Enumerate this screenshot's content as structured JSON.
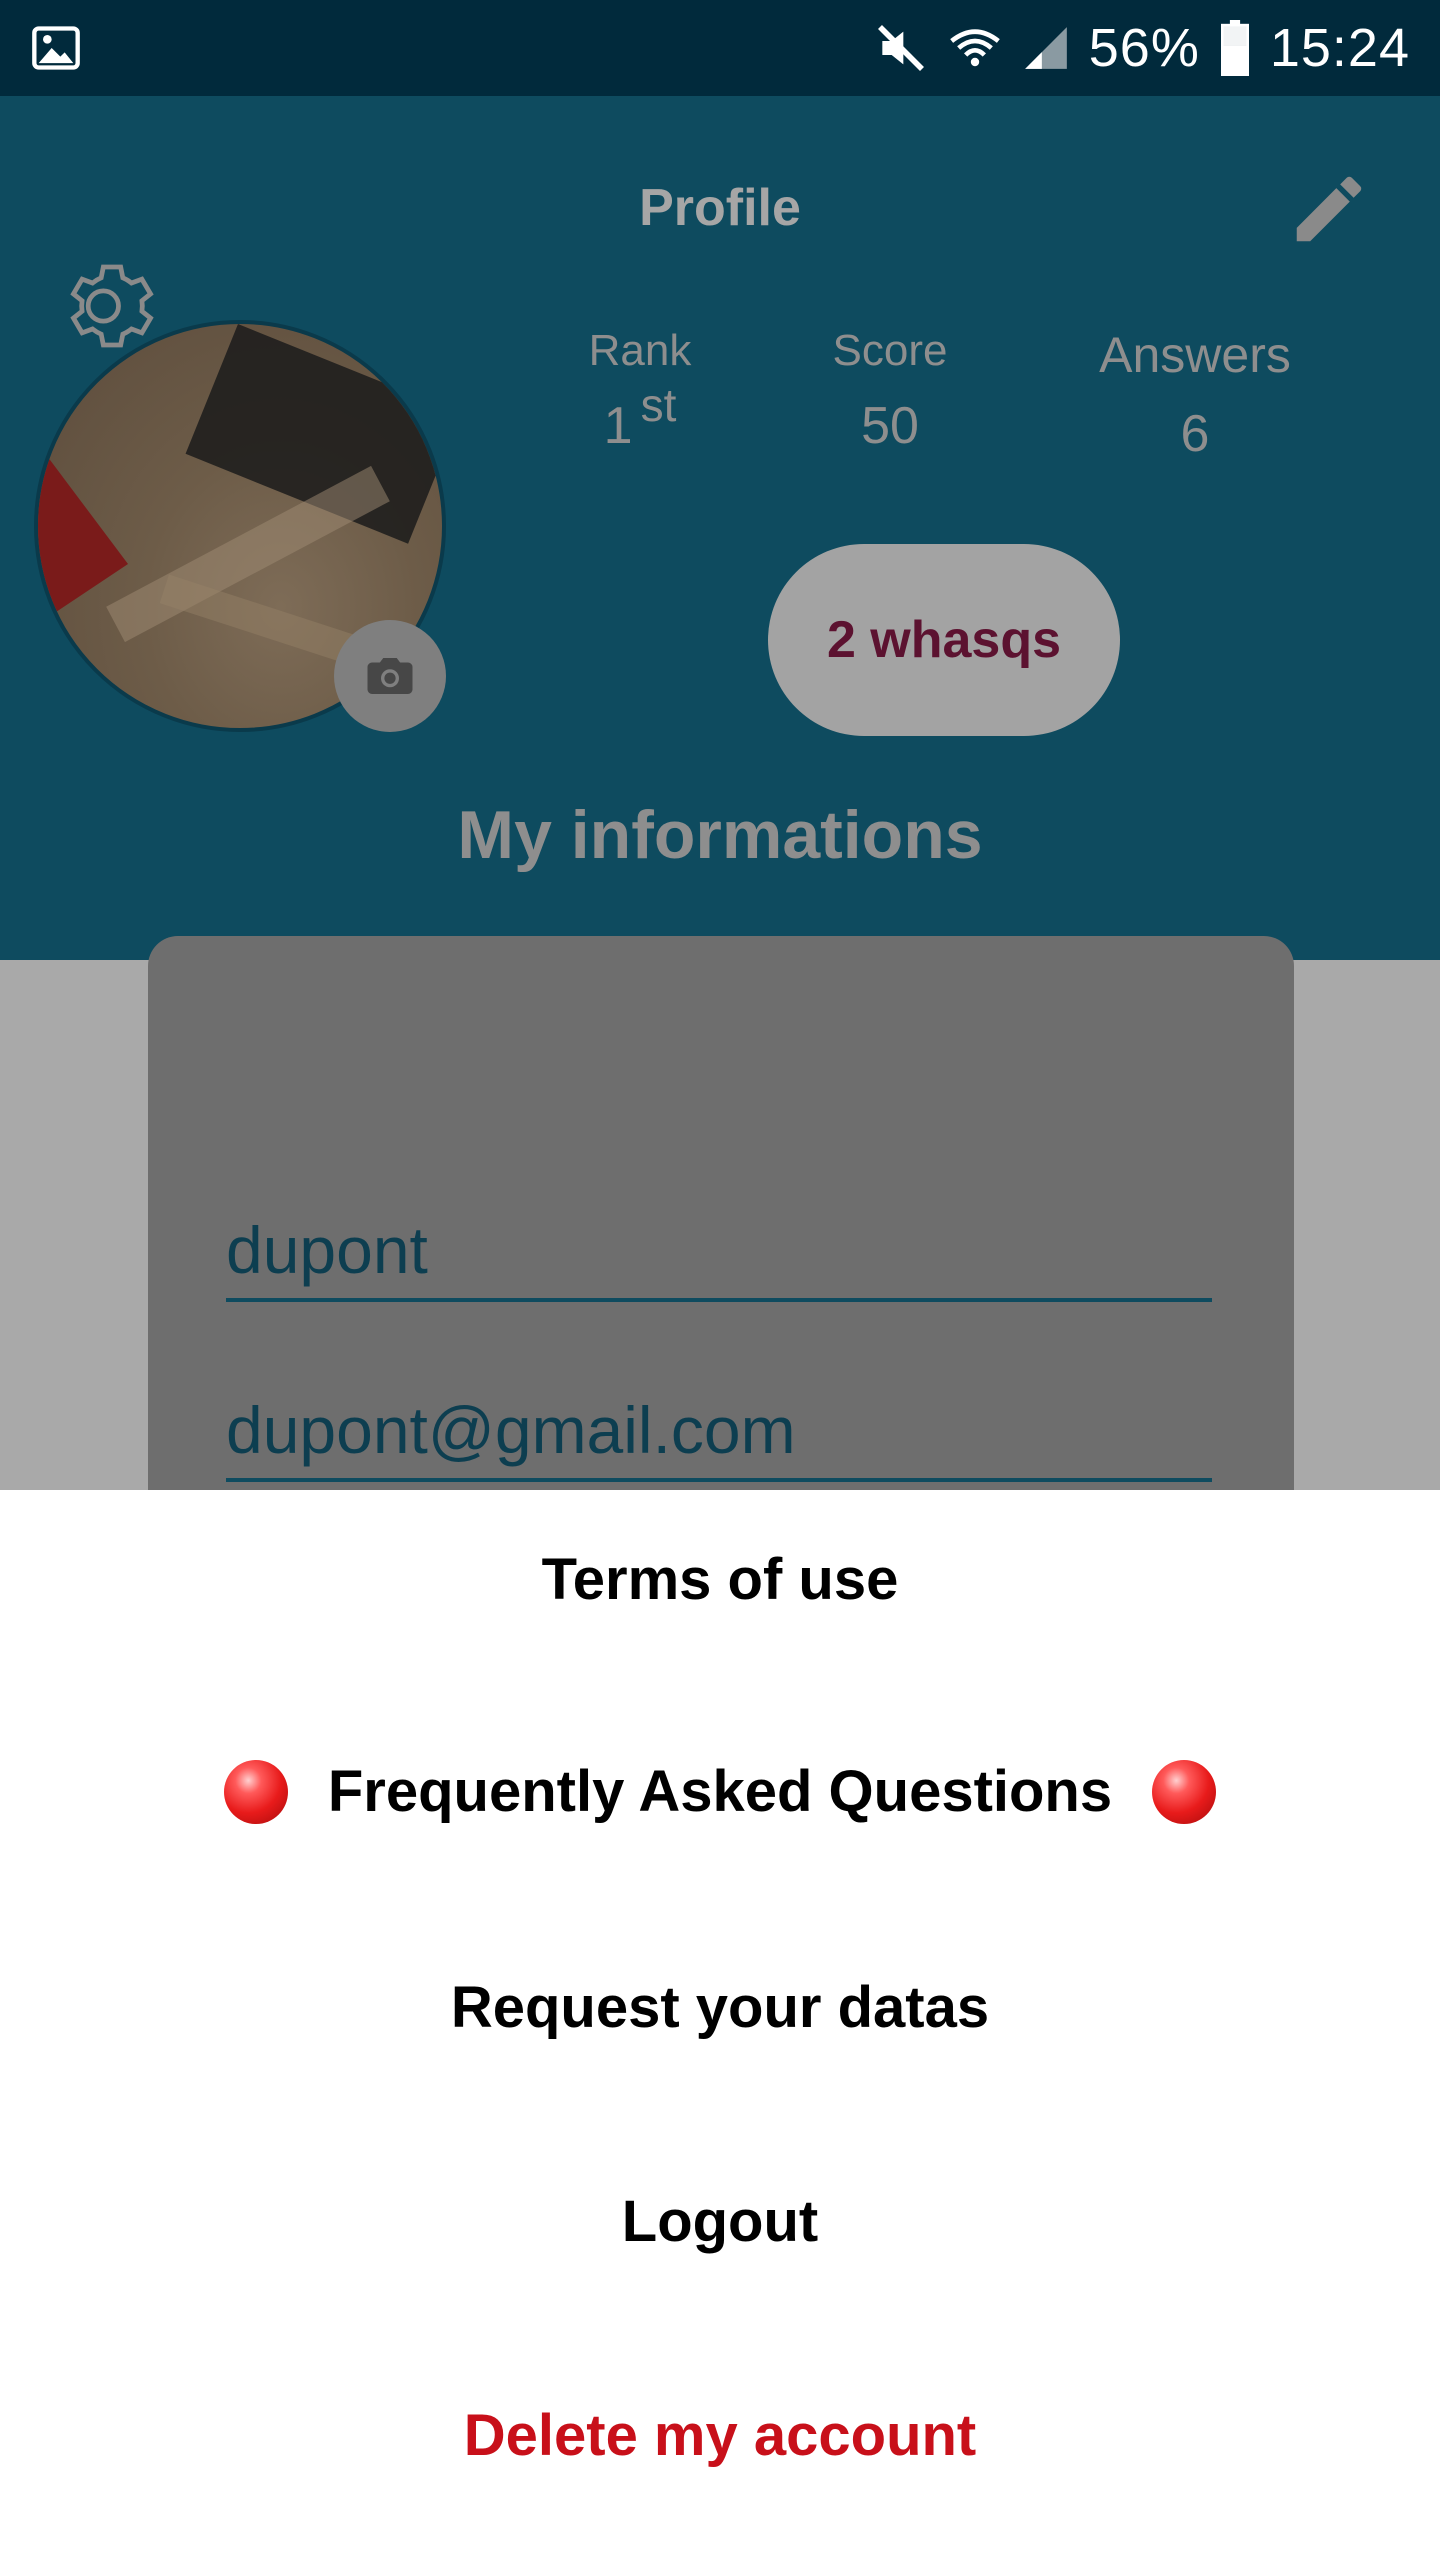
{
  "status_bar": {
    "battery": "56%",
    "time": "15:24",
    "icons": [
      "gallery-icon",
      "mute-icon",
      "wifi-icon",
      "signal-icon",
      "battery-icon"
    ]
  },
  "header": {
    "title": "Profile",
    "left_icon": "gear-icon",
    "right_icon": "pencil-icon"
  },
  "profile": {
    "camera_icon": "camera-icon",
    "stats": {
      "rank_label": "Rank",
      "rank_value": "1",
      "rank_suffix": "st",
      "score_label": "Score",
      "score_value": "50",
      "answers_label": "Answers",
      "answers_value": "6"
    },
    "whasqs_button": "2 whasqs",
    "section_title": "My informations"
  },
  "form": {
    "name_value": "dupont",
    "email_value": "dupont@gmail.com"
  },
  "sheet": {
    "terms": "Terms of use",
    "faq": "Frequently Asked Questions",
    "request_data": "Request your datas",
    "logout": "Logout",
    "delete": "Delete my account"
  },
  "colors": {
    "status_bar": "#012a3c",
    "header_dimmed": "#0e4b5f",
    "delete_red": "#c8101a",
    "whasqs_text": "#5c1230"
  }
}
